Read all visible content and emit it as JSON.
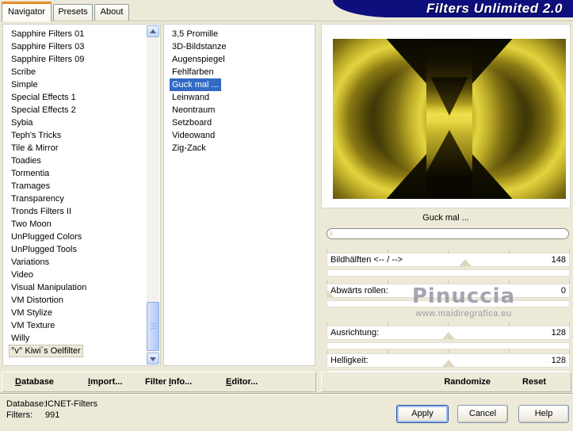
{
  "window": {
    "title": "Filters Unlimited 2.0"
  },
  "tabs": [
    {
      "label": "Navigator",
      "active": true
    },
    {
      "label": "Presets"
    },
    {
      "label": "About"
    }
  ],
  "navigator": {
    "items": [
      {
        "label": "Sapphire Filters 01"
      },
      {
        "label": "Sapphire Filters 03"
      },
      {
        "label": "Sapphire Filters 09"
      },
      {
        "label": "Scribe"
      },
      {
        "label": "Simple"
      },
      {
        "label": "Special Effects 1"
      },
      {
        "label": "Special Effects 2"
      },
      {
        "label": "Sybia"
      },
      {
        "label": "Teph's Tricks"
      },
      {
        "label": "Tile & Mirror"
      },
      {
        "label": "Toadies"
      },
      {
        "label": "Tormentia"
      },
      {
        "label": "Tramages"
      },
      {
        "label": "Transparency"
      },
      {
        "label": "Tronds Filters II"
      },
      {
        "label": "Two Moon"
      },
      {
        "label": "UnPlugged Colors"
      },
      {
        "label": "UnPlugged Tools"
      },
      {
        "label": "Variations"
      },
      {
        "label": "Video"
      },
      {
        "label": "Visual Manipulation"
      },
      {
        "label": "VM Distortion"
      },
      {
        "label": "VM Stylize"
      },
      {
        "label": "VM Texture"
      },
      {
        "label": "Willy"
      },
      {
        "label": "°v° Kiwi`s Oelfilter",
        "selected": true
      }
    ]
  },
  "filters": {
    "items": [
      {
        "label": "3,5 Promille"
      },
      {
        "label": "3D-Bildstanze"
      },
      {
        "label": "Augenspiegel"
      },
      {
        "label": "Fehlfarben"
      },
      {
        "label": "Guck mal ...",
        "selected": true
      },
      {
        "label": "Leinwand"
      },
      {
        "label": "Neontraum"
      },
      {
        "label": "Setzboard"
      },
      {
        "label": "Videowand"
      },
      {
        "label": "Zig-Zack"
      }
    ]
  },
  "preview": {
    "name": "Guck mal ..."
  },
  "sliders": [
    {
      "label": "Bildhälften <-- / -->",
      "value": "148",
      "percent": 57
    },
    {
      "label": "Abwärts rollen:",
      "value": "0",
      "percent": 0
    },
    {
      "label": "Ausrichtung:",
      "value": "128",
      "percent": 50
    },
    {
      "label": "Helligkeit:",
      "value": "128",
      "percent": 50
    }
  ],
  "watermark": {
    "name": "Pinuccia",
    "url": "www.maidiregrafica.eu"
  },
  "toolbar": {
    "database": [
      {
        "t": "D",
        "u": true
      },
      {
        "t": "atabase"
      }
    ],
    "import": [
      {
        "t": "I",
        "u": true
      },
      {
        "t": "mport..."
      }
    ],
    "filter_info": [
      {
        "t": "Filter "
      },
      {
        "t": "I",
        "u": true
      },
      {
        "t": "nfo..."
      }
    ],
    "editor": [
      {
        "t": "E",
        "u": true
      },
      {
        "t": "ditor..."
      }
    ],
    "randomize": "Randomize",
    "reset": "Reset"
  },
  "status": {
    "database_label": "Database:",
    "database_value": "ICNET-Filters",
    "filters_label": "Filters:",
    "filters_value": "991"
  },
  "actions": {
    "apply": "Apply",
    "cancel": "Cancel",
    "help": "Help"
  },
  "colors": {
    "banner": "#0e0e7d",
    "selection": "#316ac5",
    "tab_accent": "#e78a27",
    "preview_yellow": "#e2d440"
  }
}
